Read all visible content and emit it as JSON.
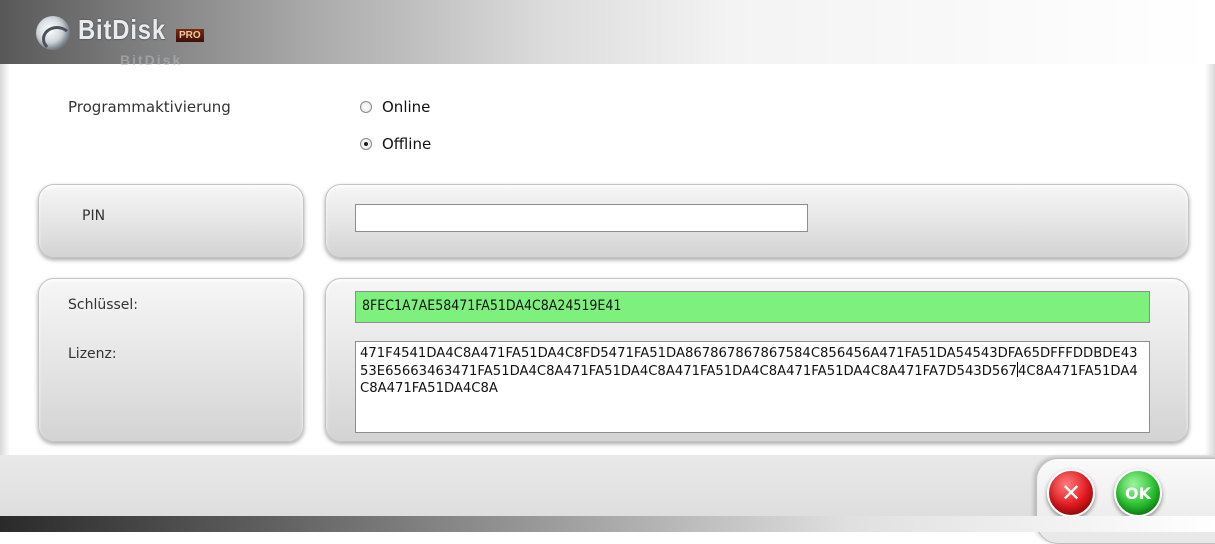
{
  "app": {
    "logo_text": "BitDisk",
    "logo_badge": "PRO",
    "logo_reflection": "BitDisk"
  },
  "activation": {
    "label": "Programmaktivierung",
    "options": [
      {
        "label": "Online",
        "selected": false
      },
      {
        "label": "Offline",
        "selected": true
      }
    ]
  },
  "pin": {
    "label": "PIN",
    "value": ""
  },
  "key": {
    "label": "Schlüssel:",
    "value": "8FEC1A7AE58471FA51DA4C8A24519E41",
    "highlight_color": "#7ef07e"
  },
  "license": {
    "label": "Lizenz:",
    "value_before_caret": "471F4541DA4C8A471FA51DA4C8FD5471FA51DA867867867867584C856456A471FA51DA54543DFA65DFFFDDBDE4353E65663463471FA51DA4C8A471FA51DA4C8A471FA51DA4C8A471FA51DA4C8A471FA7D543D567",
    "value_after_caret": "4C8A471FA51DA4C8A471FA51DA4C8A"
  },
  "buttons": {
    "cancel_label": "✕",
    "ok_label": "OK"
  },
  "colors": {
    "cancel": "#e0181c",
    "ok": "#26c02b"
  }
}
